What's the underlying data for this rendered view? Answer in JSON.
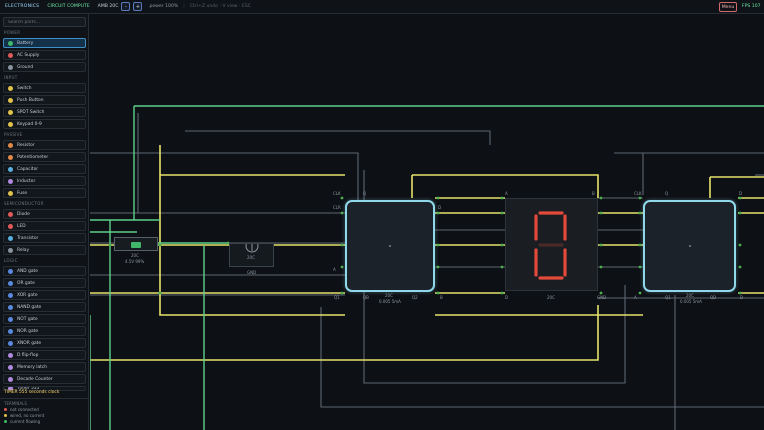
{
  "topbar": {
    "title": "ELECTRONICS",
    "subtitle": "CIRCUIT COMPUTE",
    "ambient": "AMB 20C",
    "step_down": "-",
    "step_up": "+",
    "power": "power 100%",
    "hint_sep": "|",
    "hint": "Ctrl+Z undo · V view · ESC",
    "menu": "Menu",
    "fps": "FPS 107"
  },
  "sidebar": {
    "search_placeholder": "Search parts...",
    "categories": {
      "power": "POWER",
      "input": "INPUT",
      "passive": "PASSIVE",
      "semiconductor": "SEMICONDUCTOR",
      "logic": "LOGIC"
    },
    "items": [
      {
        "label": "Battery",
        "icon": "battery-icon",
        "color": "#3fb86b"
      },
      {
        "label": "AC Supply",
        "icon": "ac-supply-icon",
        "color": "#e05a5a"
      },
      {
        "label": "Ground",
        "icon": "ground-icon",
        "color": "#8a94a0"
      },
      {
        "label": "Switch",
        "icon": "switch-icon",
        "color": "#e0c34a"
      },
      {
        "label": "Push Button",
        "icon": "push-button-icon",
        "color": "#e0c34a"
      },
      {
        "label": "SPDT Switch",
        "icon": "spdt-switch-icon",
        "color": "#e0c34a"
      },
      {
        "label": "Keypad 0-9",
        "icon": "keypad-icon",
        "color": "#e0c34a"
      },
      {
        "label": "Resistor",
        "icon": "resistor-icon",
        "color": "#e08a4a"
      },
      {
        "label": "Potentiometer",
        "icon": "potentiometer-icon",
        "color": "#e08a4a"
      },
      {
        "label": "Capacitor",
        "icon": "capacitor-icon",
        "color": "#5ab0e0"
      },
      {
        "label": "Inductor",
        "icon": "inductor-icon",
        "color": "#b08ae0"
      },
      {
        "label": "Fuse",
        "icon": "fuse-icon",
        "color": "#e0c34a"
      },
      {
        "label": "Diode",
        "icon": "diode-icon",
        "color": "#e05a5a"
      },
      {
        "label": "LED",
        "icon": "led-icon",
        "color": "#e05a5a"
      },
      {
        "label": "Transistor",
        "icon": "transistor-icon",
        "color": "#5ab0e0"
      },
      {
        "label": "Relay",
        "icon": "relay-icon",
        "color": "#8a94a0"
      },
      {
        "label": "AND gate",
        "icon": "and-gate-icon",
        "color": "#5a8ae0"
      },
      {
        "label": "OR gate",
        "icon": "or-gate-icon",
        "color": "#5a8ae0"
      },
      {
        "label": "XOR gate",
        "icon": "xor-gate-icon",
        "color": "#5a8ae0"
      },
      {
        "label": "NAND gate",
        "icon": "nand-gate-icon",
        "color": "#5a8ae0"
      },
      {
        "label": "NOT gate",
        "icon": "not-gate-icon",
        "color": "#5a8ae0"
      },
      {
        "label": "NOR gate",
        "icon": "nor-gate-icon",
        "color": "#5a8ae0"
      },
      {
        "label": "XNOR gate",
        "icon": "xnor-gate-icon",
        "color": "#5a8ae0"
      },
      {
        "label": "D flip-flop",
        "icon": "flip-flop-icon",
        "color": "#b08ae0"
      },
      {
        "label": "Memory latch",
        "icon": "memory-latch-icon",
        "color": "#b08ae0"
      },
      {
        "label": "Decade Counter",
        "icon": "decade-counter-icon",
        "color": "#b08ae0"
      },
      {
        "label": "Timer 555",
        "icon": "timer-icon",
        "color": "#b08ae0"
      }
    ],
    "timer_text": "TIMER 555 seconds clock",
    "legend": {
      "title": "TERMINALS",
      "entries": [
        {
          "label": "not connected",
          "color": "#e05a5a"
        },
        {
          "label": "wired, no current",
          "color": "#e0c34a"
        },
        {
          "label": "current flowing",
          "color": "#3fb86b"
        }
      ]
    }
  },
  "canvas": {
    "colors": {
      "yellow": "#e6e26a",
      "green": "#5fd08a",
      "gray": "#5c6670",
      "pin_green": "#4caf50",
      "segment_red": "#e34a3a"
    },
    "battery": {
      "label": "20C",
      "reading": "4.5V 99%"
    },
    "ground": {
      "label": "20C",
      "sub": "GND"
    },
    "chip_left": {
      "temp": "20C",
      "reading": "0.005 5mA",
      "pins": {
        "clk": "CLK",
        "q": "Q",
        "clr": "CLR",
        "d": "D",
        "a": "A",
        "b": "B",
        "q1": "Q1",
        "qb": "QB",
        "q2": "Q2"
      }
    },
    "seven_seg": {
      "temp": "20C",
      "digit": "0",
      "pin_a": "A",
      "pin_b": "B",
      "pin_d": "D",
      "pin_gnd": "GND"
    },
    "chip_right": {
      "temp": "20C",
      "reading": "0.005 5mA",
      "pins": {
        "clk": "CLK",
        "q": "Q",
        "d": "D",
        "a": "A",
        "q1": "Q1",
        "qd": "QD",
        "d2": "D"
      }
    }
  }
}
